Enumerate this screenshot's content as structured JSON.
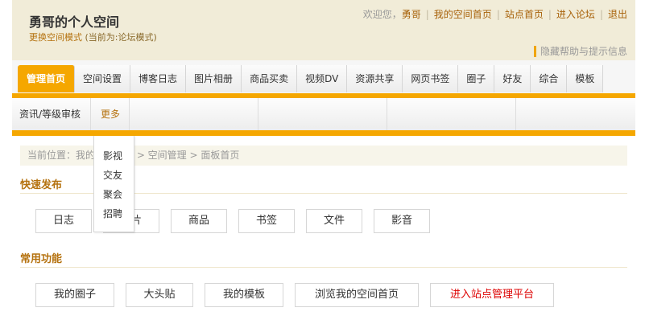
{
  "header": {
    "site_title": "勇哥的个人空间",
    "switch_mode": "更换空间模式",
    "current_mode": "(当前为:论坛模式)",
    "welcome": "欢迎您，",
    "username": "勇哥",
    "links": [
      "我的空间首页",
      "站点首页",
      "进入论坛",
      "退出"
    ],
    "help_toggle": "隐藏帮助与提示信息"
  },
  "nav": {
    "tabs": [
      "管理首页",
      "空间设置",
      "博客日志",
      "图片相册",
      "商品买卖",
      "视频DV",
      "资源共享",
      "网页书签",
      "圈子",
      "好友",
      "综合",
      "模板"
    ],
    "active_index": 0
  },
  "subnav": {
    "items": [
      "资讯/等级审核",
      "更多"
    ],
    "more_menu": [
      "影视",
      "交友",
      "聚会",
      "招聘"
    ]
  },
  "breadcrumb": "当前位置：我的空间管理 > 空间管理 > 面板首页",
  "quick_publish": {
    "title": "快速发布",
    "buttons": [
      "日志",
      "图片",
      "商品",
      "书签",
      "文件",
      "影音"
    ]
  },
  "common": {
    "title": "常用功能",
    "buttons": [
      "我的圈子",
      "大头贴",
      "我的模板",
      "浏览我的空间首页",
      "进入站点管理平台"
    ]
  },
  "colors": {
    "accent": "#f5a700",
    "brand_text": "#b5720f",
    "header_bg": "#f1ecd8",
    "danger": "#dd0000"
  }
}
